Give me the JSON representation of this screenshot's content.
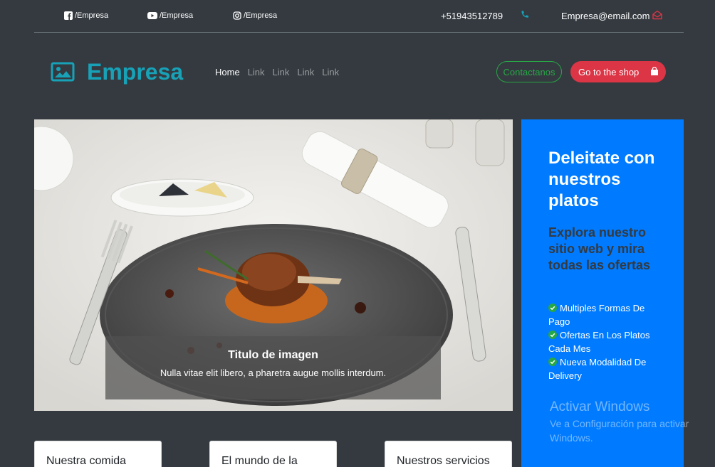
{
  "topbar": {
    "social": [
      {
        "icon": "facebook-icon",
        "label": "/Empresa"
      },
      {
        "icon": "youtube-icon",
        "label": "/Empresa"
      },
      {
        "icon": "instagram-icon",
        "label": "/Empresa"
      }
    ],
    "phone": "+51943512789",
    "email": "Empresa@email.com"
  },
  "navbar": {
    "brand": "Empresa",
    "links": [
      "Home",
      "Link",
      "Link",
      "Link",
      "Link"
    ],
    "contact_button": "Contactanos",
    "shop_button": "Go to the shop"
  },
  "carousel": {
    "caption_title": "Titulo de imagen",
    "caption_text": "Nulla vitae elit libero, a pharetra augue mollis interdum."
  },
  "side_panel": {
    "title": "Deleitate con nuestros platos",
    "subtitle": "Explora nuestro sitio web y mira todas las ofertas",
    "features": [
      "Multiples Formas De Pago",
      "Ofertas En Los Platos Cada Mes",
      "Nueva Modalidad De Delivery"
    ]
  },
  "watermark": {
    "title": "Activar Windows",
    "text": "Ve a Configuración para activar Windows."
  },
  "cards": [
    "Nuestra comida",
    "El mundo de la",
    "Nuestros servicios"
  ],
  "colors": {
    "background": "#343a40",
    "brand": "#17a2b8",
    "contact": "#28a745",
    "shop": "#dc3545",
    "panel": "#007bff"
  }
}
